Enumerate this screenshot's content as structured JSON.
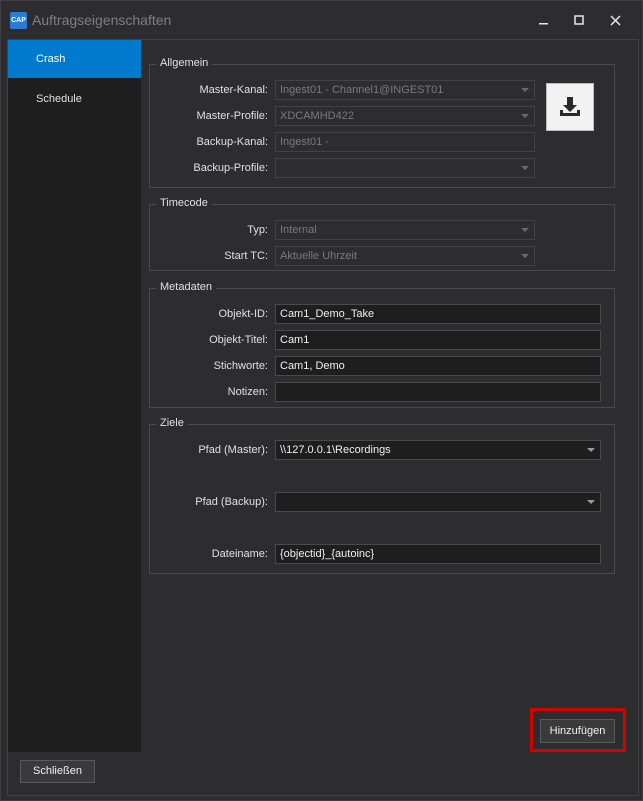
{
  "window": {
    "title": "Auftragseigenschaften",
    "app_icon_text": "CAP"
  },
  "sidebar": {
    "items": [
      {
        "label": "Crash"
      },
      {
        "label": "Schedule"
      }
    ]
  },
  "allgemein": {
    "title": "Allgemein",
    "master_kanal": {
      "label": "Master-Kanal:",
      "value": "Ingest01 - Channel1@INGEST01"
    },
    "master_profile": {
      "label": "Master-Profile:",
      "value": "XDCAMHD422"
    },
    "backup_kanal": {
      "label": "Backup-Kanal:",
      "value": "Ingest01 -"
    },
    "backup_profile": {
      "label": "Backup-Profile:",
      "value": ""
    }
  },
  "timecode": {
    "title": "Timecode",
    "typ": {
      "label": "Typ:",
      "value": "Internal"
    },
    "start_tc": {
      "label": "Start TC:",
      "value": "Aktuelle Uhrzeit"
    }
  },
  "metadaten": {
    "title": "Metadaten",
    "objekt_id": {
      "label": "Objekt-ID:",
      "value": "Cam1_Demo_Take"
    },
    "objekt_titel": {
      "label": "Objekt-Titel:",
      "value": "Cam1"
    },
    "stichworte": {
      "label": "Stichworte:",
      "value": "Cam1, Demo"
    },
    "notizen": {
      "label": "Notizen:",
      "value": ""
    }
  },
  "ziele": {
    "title": "Ziele",
    "pfad_master": {
      "label": "Pfad (Master):",
      "value": "\\\\127.0.0.1\\Recordings"
    },
    "pfad_backup": {
      "label": "Pfad (Backup):",
      "value": ""
    },
    "dateiname": {
      "label": "Dateiname:",
      "value": "{objectid}_{autoinc}"
    }
  },
  "buttons": {
    "add": "Hinzufügen",
    "close": "Schließen"
  },
  "colors": {
    "accent": "#007acc",
    "highlight": "#d40000"
  }
}
